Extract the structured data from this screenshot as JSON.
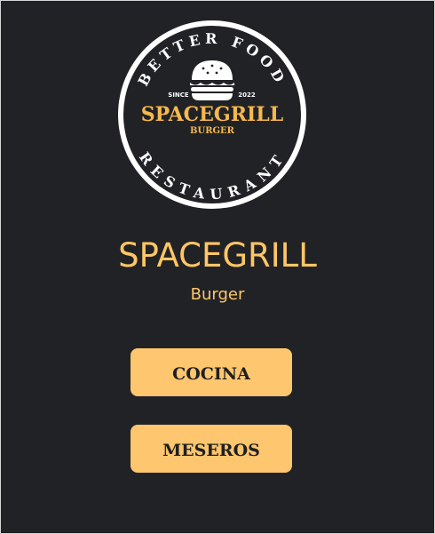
{
  "logo": {
    "arc_top_text": "BETTER FOOD",
    "arc_bottom_text": "RESTAURANT",
    "since_label": "SINCE",
    "year": "2022",
    "name": "SPACEGRILL",
    "tagline": "BURGER",
    "icon": "burger-icon",
    "ring_color": "#ffffff",
    "name_color": "#f6b94d"
  },
  "brand": {
    "title": "SPACEGRILL",
    "subtitle": "Burger"
  },
  "buttons": {
    "cocina_label": "COCINA",
    "meseros_label": "MESEROS"
  },
  "colors": {
    "background": "#212226",
    "accent": "#ffc665",
    "button": "#fec66e",
    "button_text": "#1f1f1f"
  }
}
